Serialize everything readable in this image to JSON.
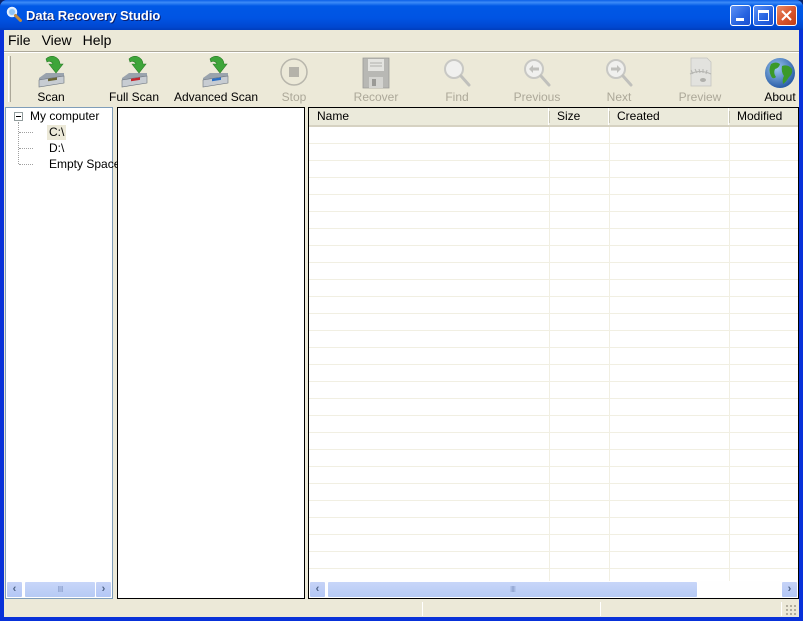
{
  "window": {
    "title": "Data Recovery Studio",
    "controls": {
      "minimize": "minimize",
      "maximize": "maximize",
      "close": "close"
    }
  },
  "menu": [
    "File",
    "View",
    "Help"
  ],
  "toolbar": [
    {
      "label": "Scan",
      "icon": "scan-drive-icon",
      "enabled": true
    },
    {
      "label": "Full Scan",
      "icon": "full-scan-drive-icon",
      "enabled": true
    },
    {
      "label": "Advanced Scan",
      "icon": "advanced-scan-drive-icon",
      "enabled": true
    },
    {
      "label": "Stop",
      "icon": "stop-icon",
      "enabled": false
    },
    {
      "label": "Recover",
      "icon": "floppy-disk-icon",
      "enabled": false
    },
    {
      "label": "Find",
      "icon": "magnifier-icon",
      "enabled": false
    },
    {
      "label": "Previous",
      "icon": "previous-magnifier-icon",
      "enabled": false
    },
    {
      "label": "Next",
      "icon": "next-magnifier-icon",
      "enabled": false
    },
    {
      "label": "Preview",
      "icon": "preview-icon",
      "enabled": false
    },
    {
      "label": "About",
      "icon": "globe-icon",
      "enabled": true
    }
  ],
  "tree": {
    "root": "My computer",
    "children": [
      "C:\\",
      "D:\\",
      "Empty Space"
    ],
    "selected": "C:\\"
  },
  "listview": {
    "columns": [
      "Name",
      "Size",
      "Created",
      "Modified"
    ],
    "rows": []
  },
  "statusbar": {
    "panels": [
      "",
      "",
      ""
    ]
  }
}
